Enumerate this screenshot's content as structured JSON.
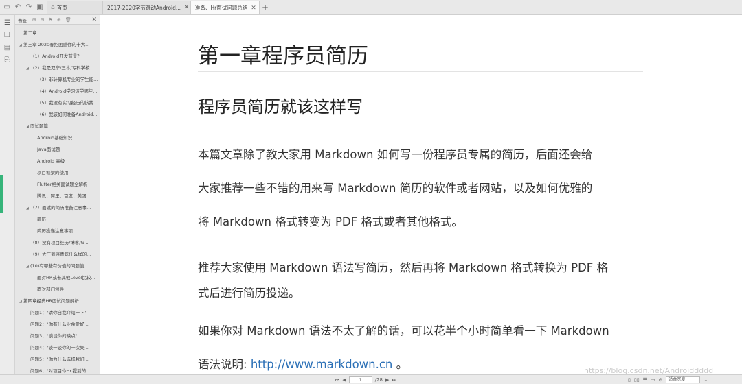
{
  "tabs": [
    {
      "label": "首页",
      "closable": false
    },
    {
      "label": "2017-2020字节跳动Android...",
      "closable": true
    },
    {
      "label": "准备、Hr面试问题总结",
      "closable": true
    }
  ],
  "outline": {
    "title": "书签",
    "items": [
      {
        "text": "第二章",
        "level": 0
      },
      {
        "text": "第三章 2020春招困惑你的十大...",
        "level": 0,
        "arrow": true
      },
      {
        "text": "（1）Android开发前景？",
        "level": 1
      },
      {
        "text": "（2）我是双非/三本/专科学校...",
        "level": 1,
        "arrow": true
      },
      {
        "text": "（3）非计算机专业的学生能...",
        "level": 2
      },
      {
        "text": "（4）Android学习该学哪些...",
        "level": 2
      },
      {
        "text": "（5）我没有实习经历的该找...",
        "level": 2
      },
      {
        "text": "（6）我该如何准备Android...",
        "level": 2
      },
      {
        "text": "面试题篇",
        "level": 1,
        "arrow": true
      },
      {
        "text": "Android基础知识",
        "level": 2
      },
      {
        "text": "Java面试题",
        "level": 2
      },
      {
        "text": "Android 高级",
        "level": 2
      },
      {
        "text": "项目框架的使用",
        "level": 2
      },
      {
        "text": "Flutter相关面试题全解析",
        "level": 2
      },
      {
        "text": "腾讯、阿里、百度、美团...",
        "level": 2
      },
      {
        "text": "（7）面试的简历准备注意事...",
        "level": 1,
        "arrow": true
      },
      {
        "text": "简历",
        "level": 2
      },
      {
        "text": "简历投递注意事项",
        "level": 2
      },
      {
        "text": "（8）没有项目经历/博客/Gi...",
        "level": 1
      },
      {
        "text": "（9）大厂到底青睐什么样的...",
        "level": 1
      },
      {
        "text": "(10)有哪些有价值的问题值...",
        "level": 1,
        "arrow": true
      },
      {
        "text": "面对HR或者其他Level比较...",
        "level": 2
      },
      {
        "text": "面对部门领导",
        "level": 2
      },
      {
        "text": "第四章经典HR面试问题解析",
        "level": 0,
        "arrow": true
      },
      {
        "text": "问题1：\"请你自我介绍一下\"",
        "level": 1
      },
      {
        "text": "问题2：\"你有什么业余爱好...",
        "level": 1
      },
      {
        "text": "问题3：\"谈谈你的缺点\"",
        "level": 1
      },
      {
        "text": "问题4：\"谈一谈你的一次失...",
        "level": 1
      },
      {
        "text": "问题5：\"你为什么选择我们...",
        "level": 1
      },
      {
        "text": "问题6：\"对项目你Hr.提到的...",
        "level": 1
      }
    ]
  },
  "doc": {
    "h1": "第一章程序员简历",
    "h2": "程序员简历就该这样写",
    "p1": "本篇文章除了教大家用 Markdown 如何写一份程序员专属的简历，后面还会给",
    "p2": "大家推荐一些不错的用来写 Markdown 简历的软件或者网站，以及如何优雅的",
    "p3": "将 Markdown 格式转变为 PDF 格式或者其他格式。",
    "p4": "推荐大家使用 Markdown 语法写简历，然后再将 Markdown 格式转换为 PDF 格",
    "p5": "式后进行简历投递。",
    "p6": "如果你对 Markdown 语法不太了解的话，可以花半个小时简单看一下 Markdown",
    "p7_prefix": "语法说明: ",
    "p7_link": "http://www.markdown.cn",
    "p7_suffix": " 。"
  },
  "status": {
    "page_current": "1",
    "page_total": "/28",
    "zoom": "适合宽度"
  },
  "watermark": "https://blog.csdn.net/Androiddddd"
}
